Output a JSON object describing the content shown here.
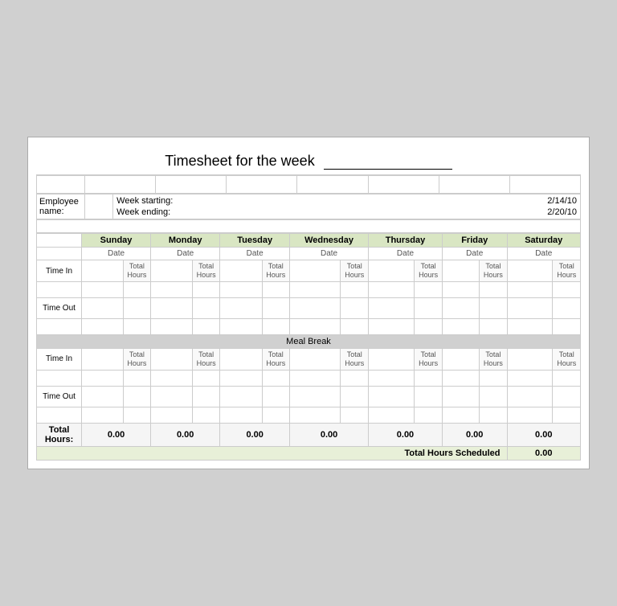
{
  "title": "Timesheet for the week",
  "employee": {
    "label": "Employee name:",
    "value": ""
  },
  "week": {
    "starting_label": "Week starting:",
    "starting_value": "2/14/10",
    "ending_label": "Week ending:",
    "ending_value": "2/20/10"
  },
  "days": [
    "Sunday",
    "Monday",
    "Tuesday",
    "Wednesday",
    "Thursday",
    "Friday",
    "Saturday"
  ],
  "date_label": "Date",
  "total_hours_label": "Total\nHours",
  "total_hours_line1": "Total",
  "total_hours_line2": "Hours",
  "section1": {
    "time_in_label": "Time In",
    "time_out_label": "Time Out"
  },
  "meal_break_label": "Meal Break",
  "section2": {
    "time_in_label": "Time In",
    "time_out_label": "Time Out"
  },
  "total_hours_row_label": "Total Hours:",
  "day_totals": [
    "0.00",
    "0.00",
    "0.00",
    "0.00",
    "0.00",
    "0.00",
    "0.00"
  ],
  "grand_total_label": "Total Hours Scheduled",
  "grand_total_value": "0.00"
}
